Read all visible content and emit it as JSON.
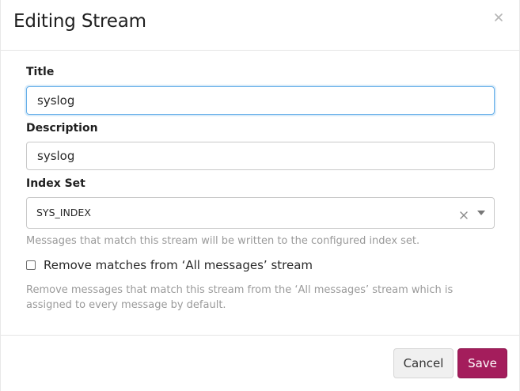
{
  "modal": {
    "title": "Editing Stream",
    "close_icon": "close-icon"
  },
  "form": {
    "title_label": "Title",
    "title_value": "syslog",
    "description_label": "Description",
    "description_value": "syslog",
    "index_set_label": "Index Set",
    "index_set_value": "SYS_INDEX",
    "index_set_help": "Messages that match this stream will be written to the configured index set.",
    "remove_matches_label": "Remove matches from ‘All messages’ stream",
    "remove_matches_checked": false,
    "remove_matches_help": "Remove messages that match this stream from the ‘All messages’ stream which is assigned to every message by default."
  },
  "footer": {
    "cancel_label": "Cancel",
    "save_label": "Save"
  },
  "colors": {
    "save_button": "#a41d5c",
    "focus_border": "#66afe9"
  }
}
